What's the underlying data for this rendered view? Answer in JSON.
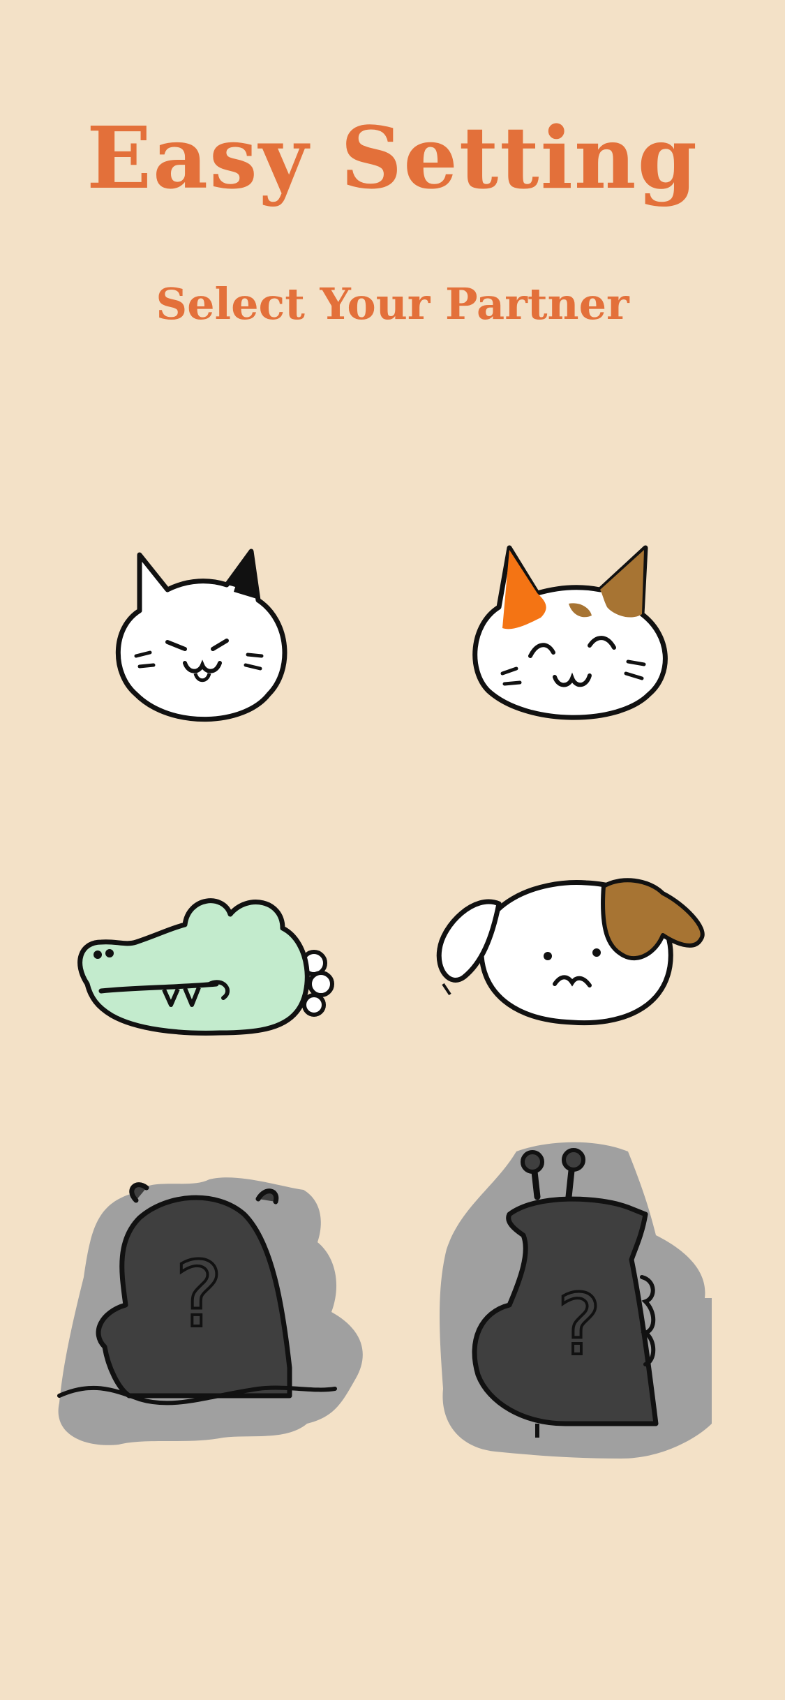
{
  "header": {
    "title": "Easy Setting",
    "subtitle": "Select Your Partner"
  },
  "partners": [
    {
      "id": "cat-black-white",
      "icon": "black-white-cat-icon",
      "locked": false
    },
    {
      "id": "cat-calico",
      "icon": "calico-cat-icon",
      "locked": false
    },
    {
      "id": "crocodile",
      "icon": "crocodile-icon",
      "locked": false
    },
    {
      "id": "dog",
      "icon": "dog-icon",
      "locked": false
    },
    {
      "id": "hippo",
      "icon": "locked-hippo-silhouette-icon",
      "locked": true,
      "mark": "?"
    },
    {
      "id": "giraffe",
      "icon": "locked-giraffe-silhouette-icon",
      "locked": true,
      "mark": "?"
    }
  ],
  "colors": {
    "background": "#F3E1C7",
    "accent": "#E3703A",
    "locked_fill": "#3F3F3F",
    "locked_shadow": "#A0A0A0",
    "croc_green": "#C3EBCD"
  }
}
